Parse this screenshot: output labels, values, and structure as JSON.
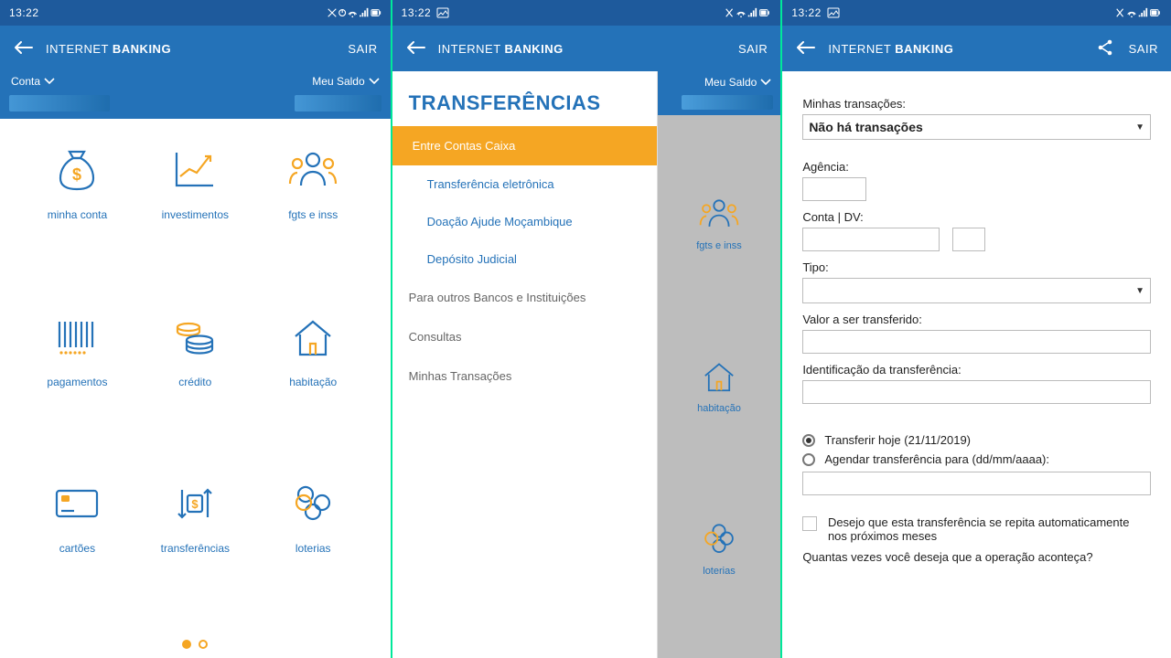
{
  "status": {
    "time": "13:22"
  },
  "appbar": {
    "title_pre": "INTERNET ",
    "title_bold": "BANKING",
    "sair": "SAIR"
  },
  "screen1": {
    "conta": "Conta",
    "saldo": "Meu Saldo",
    "tiles": [
      {
        "label": "minha conta"
      },
      {
        "label": "investimentos"
      },
      {
        "label": "fgts e inss"
      },
      {
        "label": "pagamentos"
      },
      {
        "label": "crédito"
      },
      {
        "label": "habitação"
      },
      {
        "label": "cartões"
      },
      {
        "label": "transferências"
      },
      {
        "label": "loterias"
      }
    ]
  },
  "screen2": {
    "header": "TRANSFERÊNCIAS",
    "active": "Entre Contas Caixa",
    "items": [
      "Transferência eletrônica",
      "Doação Ajude Moçambique",
      "Depósito Judicial"
    ],
    "groups": [
      "Para outros Bancos e Instituições",
      "Consultas",
      "Minhas Transações"
    ],
    "saldo": "Meu Saldo",
    "mini": [
      "fgts e inss",
      "habitação",
      "loterias"
    ]
  },
  "screen3": {
    "minhas": "Minhas transações:",
    "select_value": "Não há transações",
    "agencia": "Agência:",
    "conta_dv": "Conta | DV:",
    "tipo": "Tipo:",
    "valor": "Valor a ser transferido:",
    "ident": "Identificação da transferência:",
    "radio_hoje": "Transferir hoje (21/11/2019)",
    "radio_agendar": "Agendar transferência para (dd/mm/aaaa):",
    "chk_text": "Desejo que esta transferência se repita automaticamente nos próximos meses",
    "quantas": "Quantas vezes você deseja que a operação aconteça?"
  }
}
